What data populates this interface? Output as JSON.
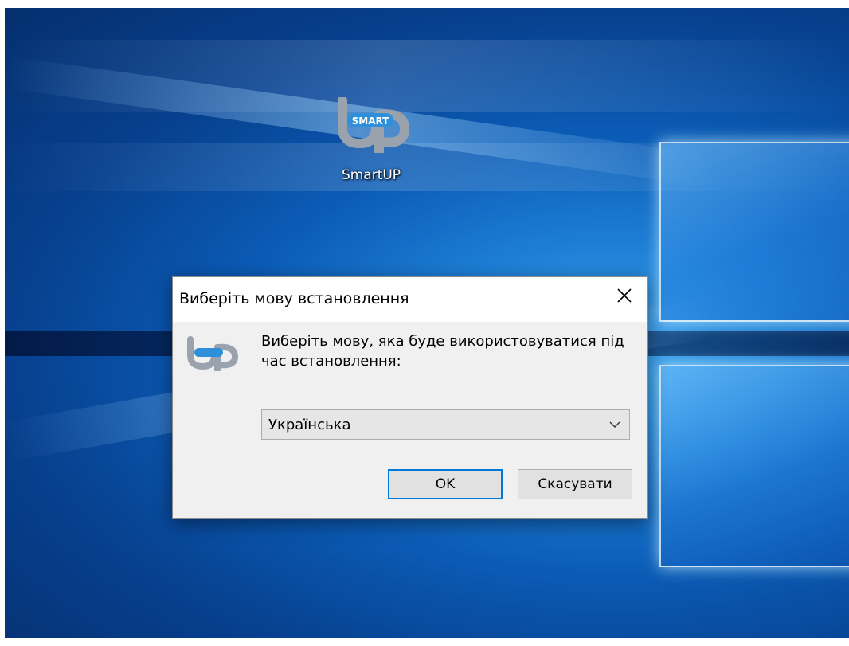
{
  "desktop": {
    "icon": {
      "icon_name": "smartup-app-icon",
      "logo_text": "SMART",
      "label": "SmartUP"
    }
  },
  "dialog": {
    "title": "Виберіть мову встановлення",
    "close_icon": "close-icon",
    "logo_icon": "smartup-logo-icon",
    "prompt": "Виберіть мову, яка буде використовуватися під час встановлення:",
    "language_select": {
      "selected": "Українська",
      "dropdown_icon": "chevron-down-icon"
    },
    "ok_label": "OK",
    "cancel_label": "Скасувати"
  },
  "colors": {
    "accent": "#0078d7",
    "dialog_bg": "#f0f0f0",
    "titlebar_bg": "#ffffff",
    "desktop_blue": "#0b5bb5"
  }
}
